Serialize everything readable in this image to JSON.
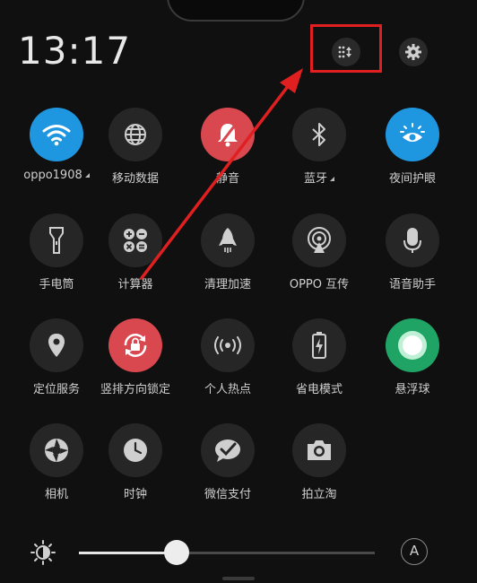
{
  "status": {
    "time": "13:17"
  },
  "tiles": [
    {
      "label": "oppo1908",
      "icon": "wifi-icon",
      "state": "on",
      "has_more": true
    },
    {
      "label": "移动数据",
      "icon": "globe-icon",
      "state": "off",
      "has_more": false
    },
    {
      "label": "静音",
      "icon": "bell-off-icon",
      "state": "alert",
      "has_more": false
    },
    {
      "label": "蓝牙",
      "icon": "bluetooth-icon",
      "state": "off",
      "has_more": true
    },
    {
      "label": "夜间护眼",
      "icon": "eye-sun-icon",
      "state": "on",
      "has_more": false
    },
    {
      "label": "手电筒",
      "icon": "flashlight-icon",
      "state": "off",
      "has_more": false
    },
    {
      "label": "计算器",
      "icon": "calculator-icon",
      "state": "off",
      "has_more": false
    },
    {
      "label": "清理加速",
      "icon": "rocket-icon",
      "state": "off",
      "has_more": false
    },
    {
      "label": "OPPO 互传",
      "icon": "share-signal-icon",
      "state": "off",
      "has_more": false
    },
    {
      "label": "语音助手",
      "icon": "microphone-icon",
      "state": "off",
      "has_more": false
    },
    {
      "label": "定位服务",
      "icon": "location-pin-icon",
      "state": "off",
      "has_more": false
    },
    {
      "label": "竖排方向锁定",
      "icon": "rotation-lock-icon",
      "state": "alert",
      "has_more": false
    },
    {
      "label": "个人热点",
      "icon": "hotspot-icon",
      "state": "off",
      "has_more": false
    },
    {
      "label": "省电模式",
      "icon": "battery-saver-icon",
      "state": "off",
      "has_more": false
    },
    {
      "label": "悬浮球",
      "icon": "floating-ball-icon",
      "state": "green",
      "has_more": false
    },
    {
      "label": "相机",
      "icon": "camera-aperture-icon",
      "state": "off",
      "has_more": false
    },
    {
      "label": "时钟",
      "icon": "clock-icon",
      "state": "off",
      "has_more": false
    },
    {
      "label": "微信支付",
      "icon": "wechat-pay-icon",
      "state": "off",
      "has_more": false
    },
    {
      "label": "拍立淘",
      "icon": "camera-icon",
      "state": "off",
      "has_more": false
    }
  ],
  "brightness": {
    "level": 0.33,
    "auto_label": "A"
  },
  "colors": {
    "on": "#1f97e0",
    "alert": "#d9474f",
    "green": "#1fa466",
    "off": "#262626",
    "highlight": "#e02020"
  }
}
